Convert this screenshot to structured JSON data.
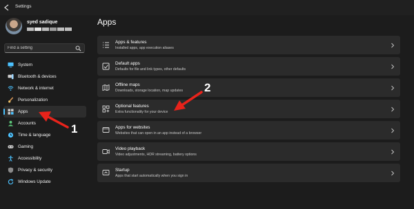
{
  "window": {
    "title": "Settings"
  },
  "profile": {
    "name": "syed sadique"
  },
  "search": {
    "placeholder": "Find a setting"
  },
  "sidebar": {
    "items": [
      {
        "label": "System",
        "icon": "monitor-icon",
        "active": false
      },
      {
        "label": "Bluetooth & devices",
        "icon": "bluetooth-icon",
        "active": false
      },
      {
        "label": "Network & internet",
        "icon": "wifi-icon",
        "active": false
      },
      {
        "label": "Personalization",
        "icon": "brush-icon",
        "active": false
      },
      {
        "label": "Apps",
        "icon": "apps-icon",
        "active": true
      },
      {
        "label": "Accounts",
        "icon": "person-icon",
        "active": false
      },
      {
        "label": "Time & language",
        "icon": "globe-clock-icon",
        "active": false
      },
      {
        "label": "Gaming",
        "icon": "controller-icon",
        "active": false
      },
      {
        "label": "Accessibility",
        "icon": "accessibility-icon",
        "active": false
      },
      {
        "label": "Privacy & security",
        "icon": "shield-icon",
        "active": false
      },
      {
        "label": "Windows Update",
        "icon": "update-icon",
        "active": false
      }
    ]
  },
  "main": {
    "title": "Apps",
    "cards": [
      {
        "title": "Apps & features",
        "subtitle": "Installed apps, app execution aliases",
        "icon": "list-icon"
      },
      {
        "title": "Default apps",
        "subtitle": "Defaults for file and link types, other defaults",
        "icon": "default-apps-icon"
      },
      {
        "title": "Offline maps",
        "subtitle": "Downloads, storage location, map updates",
        "icon": "map-icon"
      },
      {
        "title": "Optional features",
        "subtitle": "Extra functionality for your device",
        "icon": "grid-plus-icon"
      },
      {
        "title": "Apps for websites",
        "subtitle": "Websites that can open in an app instead of a browser",
        "icon": "web-app-icon"
      },
      {
        "title": "Video playback",
        "subtitle": "Video adjustments, HDR streaming, battery options",
        "icon": "video-icon"
      },
      {
        "title": "Startup",
        "subtitle": "Apps that start automatically when you sign in",
        "icon": "startup-icon"
      }
    ]
  },
  "annotations": {
    "step1": "1",
    "step2": "2"
  },
  "colors": {
    "accent": "#4cc2ff",
    "arrow": "#e8231b",
    "card_bg": "#2b2b2b",
    "window_bg": "#1c1c1c"
  }
}
